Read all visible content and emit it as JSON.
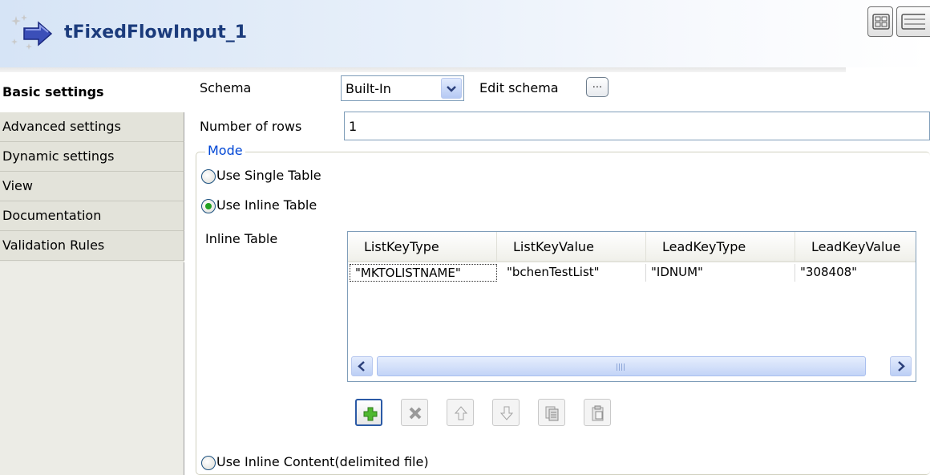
{
  "component": {
    "title": "tFixedFlowInput_1",
    "icon": "fixed-flow-input-icon"
  },
  "view_buttons": [
    {
      "icon": "grid-layout-icon"
    },
    {
      "icon": "list-layout-icon"
    }
  ],
  "sidebar": {
    "items": [
      {
        "label": "Basic settings",
        "active": true
      },
      {
        "label": "Advanced settings",
        "active": false
      },
      {
        "label": "Dynamic settings",
        "active": false
      },
      {
        "label": "View",
        "active": false
      },
      {
        "label": "Documentation",
        "active": false
      },
      {
        "label": "Validation Rules",
        "active": false
      }
    ]
  },
  "schema": {
    "label": "Schema",
    "selected": "Built-In",
    "edit_label": "Edit schema",
    "edit_button_label": "..."
  },
  "rows": {
    "label": "Number of rows",
    "value": "1"
  },
  "mode": {
    "legend": "Mode",
    "options": [
      {
        "label": "Use Single Table",
        "checked": false
      },
      {
        "label": "Use Inline Table",
        "checked": true
      },
      {
        "label": "Use Inline Content(delimited file)",
        "checked": false
      }
    ]
  },
  "inline_table": {
    "label": "Inline Table",
    "columns": [
      "ListKeyType",
      "ListKeyValue",
      "LeadKeyType",
      "LeadKeyValue"
    ],
    "rows": [
      [
        "\"MKTOLISTNAME\"",
        "\"bchenTestList\"",
        "\"IDNUM\"",
        "\"308408\""
      ]
    ],
    "scroll_left_icon": "scroll-left-icon",
    "scroll_right_icon": "scroll-right-icon"
  },
  "toolbar": {
    "buttons": [
      {
        "name": "add-row-button",
        "icon": "plus-icon",
        "enabled": true
      },
      {
        "name": "delete-row-button",
        "icon": "delete-icon",
        "enabled": false
      },
      {
        "name": "move-up-button",
        "icon": "arrow-up-icon",
        "enabled": false
      },
      {
        "name": "move-down-button",
        "icon": "arrow-down-icon",
        "enabled": false
      },
      {
        "name": "copy-button",
        "icon": "copy-icon",
        "enabled": false
      },
      {
        "name": "paste-button",
        "icon": "paste-icon",
        "enabled": false
      }
    ]
  }
}
